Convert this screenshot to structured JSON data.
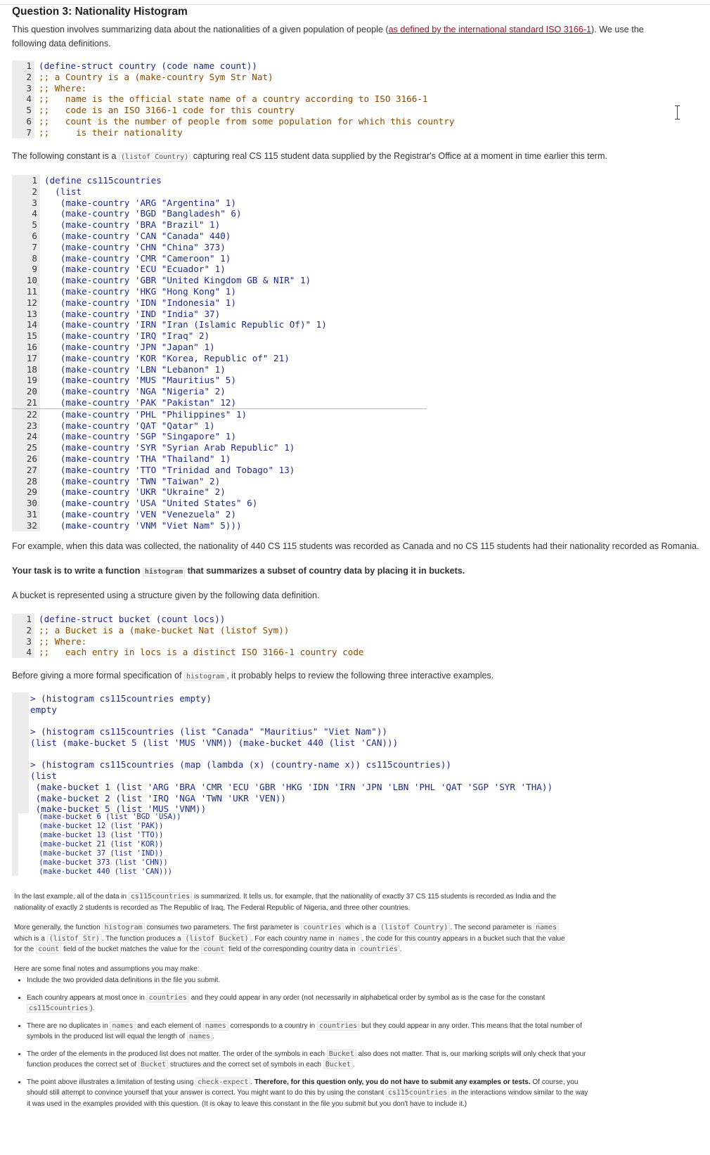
{
  "title": "Question 3: Nationality Histogram",
  "intro": {
    "text1": "This question involves summarizing data about the nationalities of a given population of people (",
    "link": "as defined by the international standard ISO 3166-1",
    "text2": "). We use the following data definitions."
  },
  "code1": [
    "(define-struct country (code name count))",
    ";; a Country is a (make-country Sym Str Nat)",
    ";; Where:",
    ";;   name is the official state name of a country according to ISO 3166-1",
    ";;   code is an ISO 3166-1 code for this country",
    ";;   count is the number of people from some population for which this country",
    ";;     is their nationality"
  ],
  "constant_para": {
    "before": "The following constant is a ",
    "code": "(listof Country)",
    "after": " capturing real CS 115 student data supplied by the Registrar's Office at a moment in time earlier this term."
  },
  "code2": [
    "(define cs115countries",
    "  (list",
    "   (make-country 'ARG \"Argentina\" 1)",
    "   (make-country 'BGD \"Bangladesh\" 6)",
    "   (make-country 'BRA \"Brazil\" 1)",
    "   (make-country 'CAN \"Canada\" 440)",
    "   (make-country 'CHN \"China\" 373)",
    "   (make-country 'CMR \"Cameroon\" 1)",
    "   (make-country 'ECU \"Ecuador\" 1)",
    "   (make-country 'GBR \"United Kingdom GB & NIR\" 1)",
    "   (make-country 'HKG \"Hong Kong\" 1)",
    "   (make-country 'IDN \"Indonesia\" 1)",
    "   (make-country 'IND \"India\" 37)",
    "   (make-country 'IRN \"Iran (Islamic Republic Of)\" 1)",
    "   (make-country 'IRQ \"Iraq\" 2)",
    "   (make-country 'JPN \"Japan\" 1)",
    "   (make-country 'KOR \"Korea, Republic of\" 21)",
    "   (make-country 'LBN \"Lebanon\" 1)",
    "   (make-country 'MUS \"Mauritius\" 5)",
    "   (make-country 'NGA \"Nigeria\" 2)",
    "   (make-country 'PAK \"Pakistan\" 12)",
    "   (make-country 'PHL \"Philippines\" 1)",
    "   (make-country 'QAT \"Qatar\" 1)",
    "   (make-country 'SGP \"Singapore\" 1)",
    "   (make-country 'SYR \"Syrian Arab Republic\" 1)",
    "   (make-country 'THA \"Thailand\" 1)",
    "   (make-country 'TTO \"Trinidad and Tobago\" 13)",
    "   (make-country 'TWN \"Taiwan\" 2)",
    "   (make-country 'UKR \"Ukraine\" 2)",
    "   (make-country 'USA \"United States\" 6)",
    "   (make-country 'VEN \"Venezuela\" 2)",
    "   (make-country 'VNM \"Viet Nam\" 5)))"
  ],
  "example_para": "For example, when this data was collected, the nationality of 440 CS 115 students was recorded as Canada and no CS 115 students had their nationality recorded as Romania.",
  "task": {
    "before": "Your task is to write a function ",
    "code": "histogram",
    "after": " that summarizes a subset of country data by placing it in buckets."
  },
  "bucket_para": "A bucket is represented using a structure given by the following data definition.",
  "code3": [
    "(define-struct bucket (count locs))",
    ";; a Bucket is a (make-bucket Nat (listof Sym))",
    ";; Where:",
    ";;   each entry in locs is a distinct ISO 3166-1 country code"
  ],
  "before_examples": {
    "before": "Before giving a more formal specification of ",
    "code": "histogram",
    "after": ", it probably helps to review the following three interactive examples."
  },
  "repl1": [
    "> (histogram cs115countries empty)",
    "empty"
  ],
  "repl2": [
    "> (histogram cs115countries (list \"Canada\" \"Mauritius\" \"Viet Nam\"))",
    "(list (make-bucket 5 (list 'MUS 'VNM)) (make-bucket 440 (list 'CAN)))"
  ],
  "repl3": [
    "> (histogram cs115countries (map (lambda (x) (country-name x)) cs115countries))",
    "(list",
    " (make-bucket 1 (list 'ARG 'BRA 'CMR 'ECU 'GBR 'HKG 'IDN 'IRN 'JPN 'LBN 'PHL 'QAT 'SGP 'SYR 'THA))",
    " (make-bucket 2 (list 'IRQ 'NGA 'TWN 'UKR 'VEN))",
    " (make-bucket 5 (list 'MUS 'VNM))"
  ],
  "repl4": [
    " (make-bucket 6 (list 'BGD 'USA))",
    " (make-bucket 12 (list 'PAK))",
    " (make-bucket 13 (list 'TTO))",
    " (make-bucket 21 (list 'KOR))",
    " (make-bucket 37 (list 'IND))",
    " (make-bucket 373 (list 'CHN))",
    " (make-bucket 440 (list 'CAN)))"
  ],
  "last_para": {
    "p1": "In the last example, all of the data in ",
    "c1": "cs115countries",
    "p2": " is summarized. It tells us, for example, that the nationality of exactly 37 CS 115 students is recorded as India and the nationality of exactly 2 students is recorded as The Republic of Iraq, The Federal Republic of Nigeria, and three other countries."
  },
  "general_para": {
    "p1": "More generally, the function ",
    "c1": "histogram",
    "p2": " consumes two parameters. The first parameter is ",
    "c2": "countries",
    "p3": " which is a ",
    "c3": "(listof Country)",
    "p4": ". The second parameter is ",
    "c4": "names",
    "p5": " which is a ",
    "c5": "(listof Str)",
    "p6": ". The function produces a ",
    "c6": "(listof Bucket)",
    "p7": ". For each country name in ",
    "c7": "names",
    "p8": ", the code for this country appears in a bucket such that the value for the ",
    "c8": "count",
    "p9": " field of the bucket matches the value for the ",
    "c9": "count",
    "p10": " field of the corresponding country data in ",
    "c10": "countries",
    "p11": "."
  },
  "notes_intro": "Here are some final notes and assumptions you may make:",
  "notes": {
    "n1": "Include the two provided data definitions in the file you submit.",
    "n2a": "Each country appears at most once in ",
    "n2c": "countries",
    "n2b": " and they could appear in any order (not necessarily in alphabetical order by symbol as is the case for the constant ",
    "n2d": "cs115countries",
    "n2e": ").",
    "n3a": "There are no duplicates in ",
    "n3c1": "names",
    "n3b": " and each element of ",
    "n3c2": "names",
    "n3d": " corresponds to a country in ",
    "n3c3": "countries",
    "n3e": " but they could appear in any order. This means that the total number of symbols in the produced list will equal the length of ",
    "n3c4": "names",
    "n3f": ".",
    "n4a": "The order of the elements in the produced list does not matter. The order of the symbols in each ",
    "n4c1": "Bucket",
    "n4b": " also does not matter. That is, our marking scripts will only check that your function produces the correct set of ",
    "n4c2": "Bucket",
    "n4d": " structures and the correct set of symbols in each ",
    "n4c3": "Bucket",
    "n4e": ".",
    "n5a": "The point above illustrates a limitation of testing using ",
    "n5c1": "check-expect",
    "n5b": ". ",
    "n5bold": "Therefore, for this question only, you do not have to submit any examples or tests.",
    "n5d": " Of course, you should still attempt to convince yourself that your answer is correct. You might want to do this by using the constant ",
    "n5c2": "cs115countries",
    "n5e": " in the interactions window similar to the way it was used in the examples provided with this question. (It is okay to leave this constant in the file you submit but you don't have to include it.)"
  }
}
